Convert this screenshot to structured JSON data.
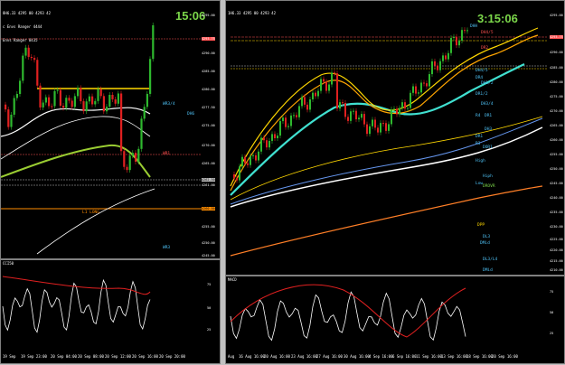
{
  "left_window": {
    "header_lines": [
      "8H6.33 4295 00 4293 42",
      "c Envs Ranger 4444",
      "Envs Ranger 8435"
    ],
    "clock": "15:06",
    "price_labels": [
      "4295.00",
      "4293.75",
      "4290.00",
      "4285.00",
      "4280.00",
      "4277.50",
      "4275.00",
      "4270.00",
      "4265.00",
      "4262.50",
      "4261.00",
      "4260.00",
      "4255.00",
      "4250.00",
      "4245.00"
    ],
    "level_tags": [
      {
        "text": "WR3/4",
        "color": "#4fc3f7"
      },
      {
        "text": "DH6",
        "color": "#4fc3f7"
      },
      {
        "text": "WR1",
        "color": "#ff5050"
      },
      {
        "text": "L1 LONG",
        "color": "#ff8c00"
      },
      {
        "text": "WR3",
        "color": "#4fc3f7"
      }
    ],
    "indicator_name": "CCI50",
    "indicator_scale": [
      "75",
      "50",
      "25"
    ],
    "dates": [
      "19 Sep",
      "19 Sep 23:00",
      "20 Sep 04:00",
      "20 Sep 08:00",
      "20 Sep 12:00",
      "20 Sep 16:00",
      "20 Sep 20:00"
    ]
  },
  "right_window": {
    "header_lines": [
      "1H6.33 4295 00 4293 42"
    ],
    "clock": "3:15:06",
    "price_labels": [
      "4295.00",
      "4293.75",
      "4290.00",
      "4285.00",
      "4280.00",
      "4275.00",
      "4270.00",
      "4265.00",
      "4260.00",
      "4255.00",
      "4250.00",
      "4245.00",
      "4240.00",
      "4235.00",
      "4230.00",
      "4225.00",
      "4220.00",
      "4215.00",
      "4210.00"
    ],
    "level_tags": [
      {
        "text": "DHH",
        "color": "#4fc3f7"
      },
      {
        "text": "DH4/5",
        "color": "#ff5050"
      },
      {
        "text": "DR2",
        "color": "#ff5050"
      },
      {
        "text": "DH4/5",
        "color": "#4fc3f7"
      },
      {
        "text": "DR4",
        "color": "#4fc3f7"
      },
      {
        "text": "DH1/2",
        "color": "#4fc3f7"
      },
      {
        "text": "DR1/2",
        "color": "#4fc3f7"
      },
      {
        "text": "DH3/4",
        "color": "#4fc3f7"
      },
      {
        "text": "R4",
        "color": "#4fc3f7"
      },
      {
        "text": "DR1",
        "color": "#4fc3f7"
      },
      {
        "text": "DH3",
        "color": "#4fc3f7"
      },
      {
        "text": "DR1",
        "color": "#4fc3f7"
      },
      {
        "text": "R3",
        "color": "#4fc3f7"
      },
      {
        "text": "DOR1",
        "color": "#4fc3f7"
      },
      {
        "text": "High",
        "color": "#4fc3f7"
      },
      {
        "text": "Hiph",
        "color": "#4fc3f7"
      },
      {
        "text": "Low",
        "color": "#4fc3f7"
      },
      {
        "text": "DROVR",
        "color": "#7bd64a"
      },
      {
        "text": "DPP",
        "color": "#ffd700"
      },
      {
        "text": "DL3",
        "color": "#4fc3f7"
      },
      {
        "text": "DMid",
        "color": "#4fc3f7"
      },
      {
        "text": "DL3/L4",
        "color": "#4fc3f7"
      },
      {
        "text": "DMid",
        "color": "#4fc3f7"
      }
    ],
    "indicator_name": "MACD",
    "indicator_scale": [
      "75",
      "50",
      "25"
    ],
    "dates": [
      "Aug",
      "16 Aug 16:00",
      "20 Aug 16:00",
      "23 Aug 16:00",
      "27 Aug 16:00",
      "30 Aug 16:00",
      "4 Sep 16:00",
      "6 Sep 16:00",
      "11 Sep 16:00",
      "13 Sep 16:00",
      "18 Sep 16:00",
      "20 Sep 16:00"
    ]
  },
  "colors": {
    "up_candle": "#2eb82e",
    "down_candle": "#e02020",
    "ema_fast": "#ffd700",
    "ema_mid": "#ffa500",
    "ema_cyan": "#40e0d0",
    "ema_white": "#ffffff",
    "ema_lime": "#9acd32",
    "ema_orange": "#ff7f27"
  }
}
